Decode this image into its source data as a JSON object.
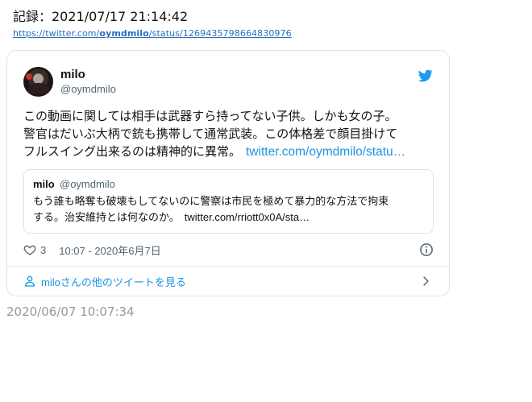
{
  "record": {
    "header": "記録：2021/07/17 21:14:42",
    "url_prefix": "https://twitter.com/",
    "url_user": "oymdmilo",
    "url_suffix": "/status/1269435798664830976"
  },
  "tweet": {
    "name": "milo",
    "handle": "@oymdmilo",
    "text": "この動画に関しては相手は武器すら持ってない子供。しかも女の子。\n警官はだいぶ大柄で銃も携帯して通常武装。この体格差で顔目掛けて\nフルスイング出来るのは精神的に異常。",
    "link": "twitter.com/oymdmilo/statu…",
    "quote": {
      "name": "milo",
      "handle": "@oymdmilo",
      "text": "もう誰も略奪も破壊もしてないのに警察は市民を極めて暴力的な方法で拘束\nする。治安維持とは何なのか。",
      "link": "twitter.com/rriott0x0A/sta…"
    },
    "likes": "3",
    "timestamp": "10:07 - 2020年6月7日",
    "more_label": "miloさんの他のツイートを見る",
    "icons": [
      "twitter-bird-icon",
      "heart-icon",
      "info-icon",
      "person-icon",
      "chevron-right-icon"
    ],
    "accent_color": "#1b95e0"
  },
  "archived_time": "2020/06/07 10:07:34"
}
